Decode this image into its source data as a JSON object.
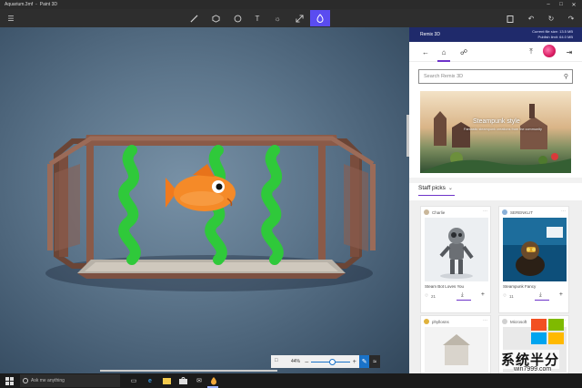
{
  "window": {
    "file_name": "Aquarium.3mf",
    "app_name": "Paint 3D",
    "controls": [
      "minimize-icon",
      "maximize-icon",
      "close-icon"
    ]
  },
  "toolbar": {
    "menu_icon": "hamburger-icon",
    "tools": [
      {
        "name": "brush-icon",
        "active": false
      },
      {
        "name": "3d-shapes-icon",
        "active": false
      },
      {
        "name": "stickers-icon",
        "active": false
      },
      {
        "name": "text-icon",
        "active": false
      },
      {
        "name": "effects-icon",
        "active": false
      },
      {
        "name": "canvas-icon",
        "active": false
      },
      {
        "name": "remix3d-icon",
        "active": true
      }
    ],
    "right_icons": [
      "paste-icon",
      "undo-icon",
      "history-icon",
      "redo-icon"
    ]
  },
  "zoom": {
    "value": "44%",
    "fraction": 0.44,
    "accent": "#1a73c9"
  },
  "panel": {
    "title": "Remix 3D",
    "storage_current": "Current file size: 13.5 MB",
    "storage_publish": "Publish limit: 64.0 MB",
    "search_placeholder": "Search Remix 3D",
    "banner_title": "Steampunk style",
    "banner_subtitle": "Fantastic steampunk creations from the community",
    "section_label": "Staff picks",
    "accent": "#6d33c9",
    "cards": [
      {
        "author": "Charlie",
        "title": "Steam Bot Loves You",
        "likes": "21"
      },
      {
        "author": "SERENKLIT",
        "title": "Steampunk Fancy",
        "likes": "11"
      },
      {
        "author": "phyllosns",
        "title": "",
        "likes": ""
      },
      {
        "author": "Microsoft",
        "title": "",
        "likes": ""
      }
    ]
  },
  "watermark": {
    "text": "系统半分",
    "url": "win7999.com"
  },
  "taskbar": {
    "search_placeholder": "Ask me anything",
    "icons": [
      "windows-start-icon",
      "task-view-icon",
      "edge-icon",
      "file-explorer-icon",
      "store-icon",
      "mail-icon",
      "paint3d-icon"
    ]
  }
}
